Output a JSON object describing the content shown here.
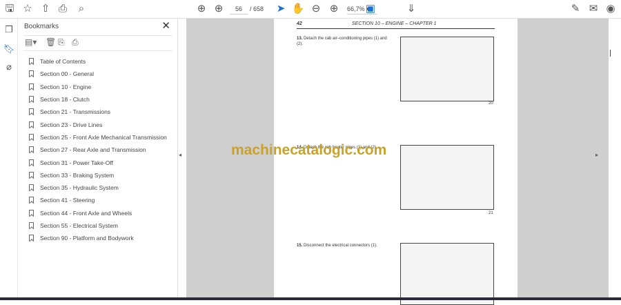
{
  "toolbar": {
    "current_page": "56",
    "total_pages": "/ 658",
    "zoom": "66,7%"
  },
  "bookmarks": {
    "title": "Bookmarks",
    "close": "✕",
    "items": [
      "Table of Contents",
      "Section 00 - General",
      "Section 10 - Engine",
      "Section 18 - Clutch",
      "Section 21 - Transmissions",
      "Section 23 - Drive Lines",
      "Section 25 - Front Axle Mechanical Transmission",
      "Section 27 - Rear Axle and Transmission",
      "Section 31 - Power Take-Off",
      "Section 33 - Braking System",
      "Section 35 - Hydraulic System",
      "Section 41 - Steering",
      "Section 44 - Front Axle and Wheels",
      "Section 55 - Electrical System",
      "Section 90 - Platform and Bodywork"
    ]
  },
  "document": {
    "page_number": "42",
    "header": "SECTION 10 – ENGINE – CHAPTER 1",
    "steps": [
      {
        "num": "13.",
        "text": "Detach the cab air–conditioning pipes (1) and (2).",
        "figure": "20"
      },
      {
        "num": "14.",
        "text": "Detach the cab heater pipes (1) and (2).",
        "figure": "21"
      },
      {
        "num": "15.",
        "text": "Disconnect the electrical connectors (1).",
        "figure": ""
      }
    ],
    "watermark": "machinecatalogic.com"
  },
  "colors": {
    "accent": "#1a6fd6",
    "watermark": "#c9a227"
  }
}
